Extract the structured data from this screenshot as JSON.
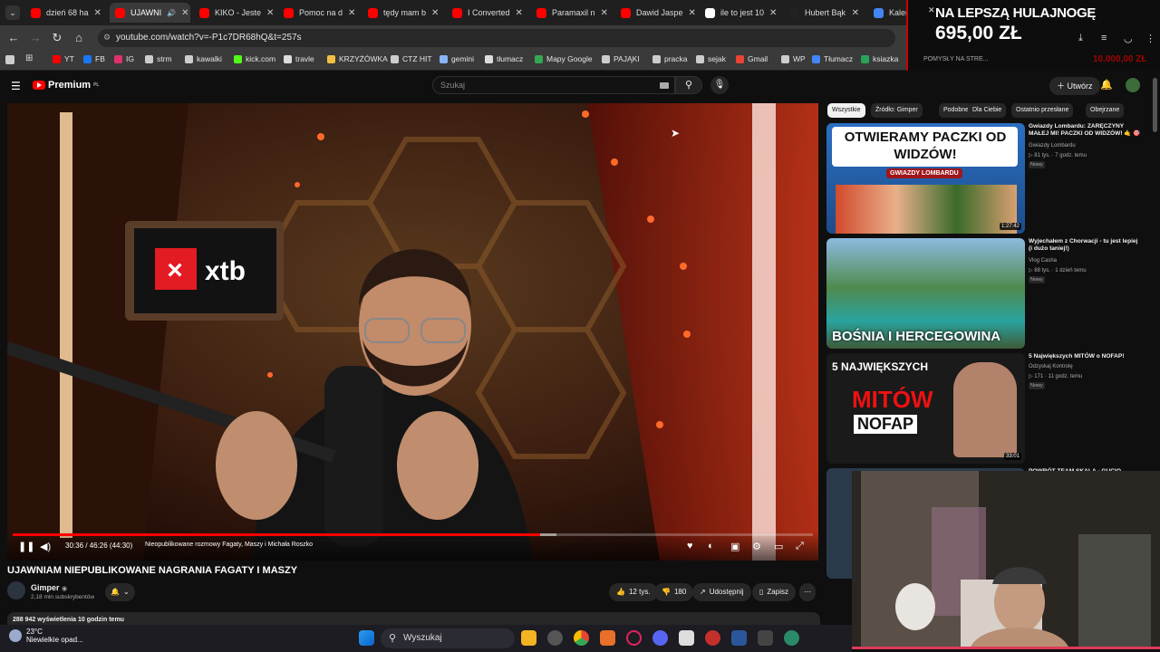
{
  "tabs": [
    {
      "label": "dzień 68 ha",
      "favicon": "youtube-icon"
    },
    {
      "label": "UJAWNI",
      "favicon": "youtube-icon",
      "active": true
    },
    {
      "label": "KIKO - Jeste",
      "favicon": "youtube-icon"
    },
    {
      "label": "Pomoc na d",
      "favicon": "youtube-icon"
    },
    {
      "label": "tędy mam b",
      "favicon": "youtube-icon"
    },
    {
      "label": "I Converted",
      "favicon": "youtube-icon"
    },
    {
      "label": "Paramaxil n",
      "favicon": "youtube-icon"
    },
    {
      "label": "Dawid Jaspe",
      "favicon": "youtube-icon"
    },
    {
      "label": "ile to jest 10",
      "favicon": "google-icon"
    },
    {
      "label": "Hubert Bąk",
      "favicon": "tiktok-icon"
    },
    {
      "label": "Kalenda",
      "favicon": "calendar-icon"
    }
  ],
  "address_bar": {
    "url": "youtube.com/watch?v=-P1c7DR68hQ&t=257s"
  },
  "bookmarks": [
    "YT",
    "FB",
    "IG",
    "strm",
    "kawalki",
    "kick.com",
    "travle",
    "KRZYŻÓWKA",
    "CTZ HIT",
    "gemini",
    "tłumacz",
    "Mapy Google",
    "PAJĄKI",
    "pracka",
    "sejak",
    "Gmail",
    "WP",
    "Tłumacz",
    "ksiazka"
  ],
  "ad_overlay": {
    "line1": "NA LEPSZĄ HULAJNOGĘ",
    "line2": "695,00 ZŁ",
    "line3": "POMYSŁY NA STRE...",
    "line4": "10.000,00 ZŁ"
  },
  "header": {
    "logo": "Premium",
    "logo_sup": "PL",
    "search_placeholder": "Szukaj",
    "create_label": "Utwórz"
  },
  "player": {
    "time": "30:36 / 46:26 (44:30)",
    "chapter": "Nieopublikowane rozmowy Fagaty, Maszy i Michała Roszko",
    "progress_fraction": 0.659,
    "buffered_fraction": 0.68,
    "sign_text": "xtb"
  },
  "video": {
    "title": "UJAWNIAM NIEPUBLIKOWANE NAGRANIA FAGATY I MASZY",
    "channel": "Gimper",
    "subscribers": "2,18 mln subskrybentów",
    "likes": "12 tys.",
    "dislikes": "180",
    "share": "Udostępnij",
    "save": "Zapisz",
    "views": "288 942 wyświetlenia  10 godzin temu"
  },
  "chips": [
    "Wszystkie",
    "Źródło: Gimper",
    "Podobne",
    "Dla Ciebie",
    "Ostatnio przesłane",
    "Obejrzane"
  ],
  "recommendations": [
    {
      "title": "Gwiazdy Lombardu: ZARĘCZYNY MAŁEJ MI! PACZKI OD WIDZÓW! 🤙 🎯",
      "channel": "Gwiazdy Lombardu",
      "meta": "81 tys. · 7 godz. temu",
      "badge": "Nowy",
      "duration": "1:27:42",
      "thumb_text": "OTWIERAMY PACZKI OD WIDZÓW!",
      "thumb_sub": "GWIAZDY LOMBARDU"
    },
    {
      "title": "Wyjechałem z Chorwacji - tu jest lepiej (i dużo taniej!)",
      "channel": "Vlog Casha",
      "meta": "88 tys. · 1 dzień temu",
      "badge": "Nowy",
      "duration": "",
      "thumb_text": "BOŚNIA I HERCEGOWINA"
    },
    {
      "title": "5 Największych MITÓW o NOFAP!",
      "channel": "Odzyskaj Kontrolę",
      "meta": "171 · 11 godz. temu",
      "badge": "Nowy",
      "duration": "33:01",
      "thumb_text": "5 NAJWIĘKSZYCH",
      "thumb_text2": "MITÓW",
      "thumb_text3": "NOFAP"
    },
    {
      "title": "POWRÓT TEAM SKALA - GUCIO",
      "channel": "",
      "meta": "",
      "badge": "",
      "duration": ""
    }
  ],
  "taskbar": {
    "temperature": "23°C",
    "weather": "Niewielkie opad...",
    "search": "Wyszukaj"
  }
}
